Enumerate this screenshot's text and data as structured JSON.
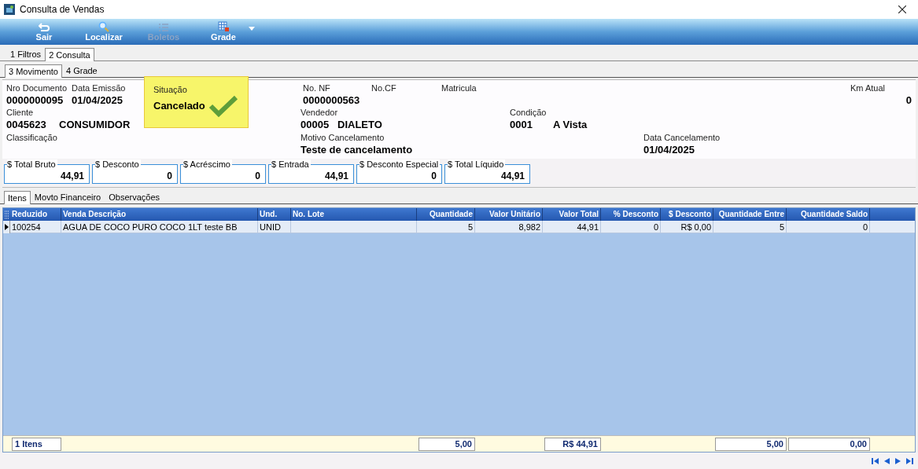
{
  "window": {
    "title": "Consulta de Vendas"
  },
  "toolbar": [
    {
      "label": "Sair",
      "kind": "exit",
      "disabled": false
    },
    {
      "label": "Localizar",
      "kind": "search",
      "disabled": false
    },
    {
      "label": "Boletos",
      "kind": "list",
      "disabled": true
    },
    {
      "label": "Grade",
      "kind": "grid",
      "disabled": false
    }
  ],
  "tabs": [
    {
      "label": "1 Filtros",
      "selected": false
    },
    {
      "label": "2 Consulta",
      "selected": true
    }
  ],
  "subtabs": [
    {
      "label": "3 Movimento",
      "selected": true
    },
    {
      "label": "4 Grade",
      "selected": false
    }
  ],
  "form": {
    "nro_documento": {
      "label": "Nro Documento",
      "value": "0000000095"
    },
    "data_emissao": {
      "label": "Data Emissão",
      "value": "01/04/2025"
    },
    "situacao": {
      "label": "Situação",
      "value": "Cancelado",
      "highlighted": true
    },
    "no_nf": {
      "label": "No. NF",
      "value": "0000000563"
    },
    "no_cf": {
      "label": "No.CF"
    },
    "matricula": {
      "label": "Matricula"
    },
    "km_atual": {
      "label": "Km Atual",
      "value": "0"
    },
    "cliente": {
      "label": "Cliente",
      "code": "0045623",
      "name": "CONSUMIDOR"
    },
    "vendedor": {
      "label": "Vendedor",
      "code": "00005",
      "name": "DIALETO"
    },
    "condicao": {
      "label": "Condição",
      "code": "0001",
      "name": "A Vista"
    },
    "classificacao": {
      "label": "Classificação"
    },
    "motivo_cancelamento": {
      "label": "Motivo Cancelamento",
      "value": "Teste de cancelamento"
    },
    "data_cancelamento": {
      "label": "Data Cancelamento",
      "value": "01/04/2025"
    }
  },
  "totals": [
    {
      "label": "$ Total Bruto",
      "value": "44,91"
    },
    {
      "label": "$ Desconto",
      "value": "0"
    },
    {
      "label": "$ Acréscimo",
      "value": "0"
    },
    {
      "label": "$ Entrada",
      "value": "44,91"
    },
    {
      "label": "$ Desconto Especial",
      "value": "0"
    },
    {
      "label": "$ Total Líquido",
      "value": "44,91"
    }
  ],
  "inner_tabs": [
    {
      "label": "Itens",
      "selected": true
    },
    {
      "label": "Movto Financeiro",
      "selected": false
    },
    {
      "label": "Observações",
      "selected": false
    }
  ],
  "table": {
    "columns": [
      "Reduzido",
      "Venda Descrição",
      "Und.",
      "No. Lote",
      "Quantidade",
      "Valor Unitário",
      "Valor Total",
      "% Desconto",
      "$ Desconto",
      "Quantidade Entre",
      "Quantidade Saldo"
    ],
    "rows": [
      {
        "selected": true,
        "cells": [
          "100254",
          "AGUA DE COCO PURO COCO 1LT teste BB",
          "UNID",
          null,
          "5",
          "8,982",
          "44,91",
          "0",
          "R$ 0,00",
          "5",
          "0"
        ]
      }
    ],
    "footer": {
      "count": "1 Itens",
      "quantidade": "5,00",
      "valor_total": "R$ 44,91",
      "quantidade_entregue": "5,00",
      "quantidade_saldo": "0,00"
    }
  }
}
